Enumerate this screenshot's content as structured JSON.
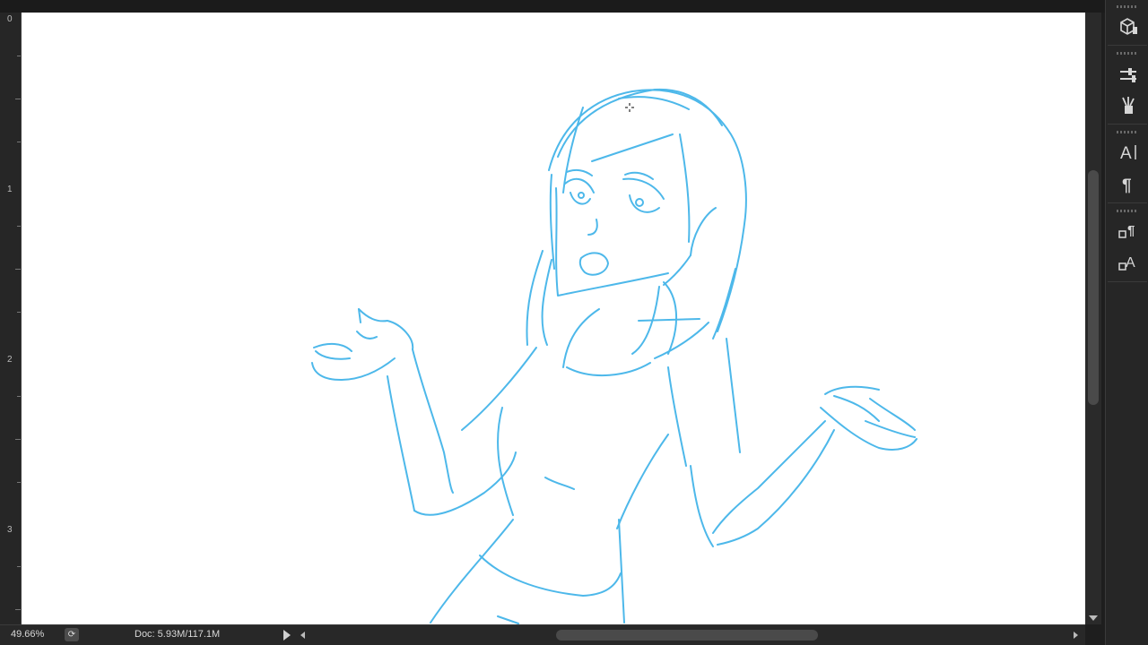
{
  "app": {
    "zoom_label": "49.66%",
    "doc_info": "Doc: 5.93M/117.1M"
  },
  "ruler": {
    "numbers": [
      "0",
      "1",
      "2",
      "3"
    ]
  },
  "colors": {
    "sketch_stroke": "#4db8ea",
    "canvas": "#ffffff",
    "ui_background": "#262626"
  },
  "panel": {
    "icons": [
      "3d-cube-icon",
      "adjustment-sliders-icon",
      "brush-presets-icon",
      "character-icon",
      "paragraph-icon",
      "paragraph-styles-icon",
      "character-styles-icon"
    ]
  }
}
